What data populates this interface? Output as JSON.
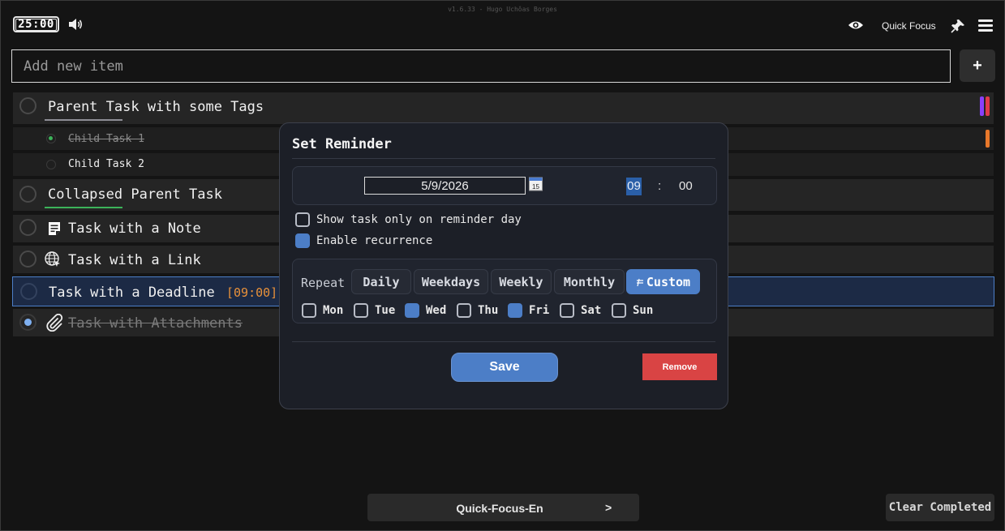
{
  "header": {
    "timer": "25:00",
    "version": "v1.6.33 - Hugo Uchôas Borges",
    "quick_focus_label": "Quick Focus"
  },
  "add_item": {
    "placeholder": "Add new item",
    "add_label": "+"
  },
  "tasks": [
    {
      "label": "Parent Task with some Tags",
      "tags": [
        "#8a3ffc",
        "#e03a4a"
      ]
    },
    {
      "label": "Child Task 1",
      "completed": true,
      "tag": "#e8782a"
    },
    {
      "label": "Child Task 2"
    },
    {
      "label": "Collapsed Parent Task"
    },
    {
      "label": "Task with a Note",
      "icon": "note-icon"
    },
    {
      "label": "Task with a Link",
      "icon": "globe-icon"
    },
    {
      "label": "Task with a Deadline",
      "deadline": "[09:00]"
    },
    {
      "label": "Task with Attachments",
      "icon": "paperclip-icon",
      "completed": true
    }
  ],
  "reminder_dialog": {
    "title": "Set Reminder",
    "date": "5/9/2026",
    "hour": "09",
    "colon": ":",
    "minute": "00",
    "show_only_on_day_label": "Show task only on reminder day",
    "show_only_on_day_checked": false,
    "enable_recurrence_label": "Enable recurrence",
    "enable_recurrence_checked": true,
    "repeat_label": "Repeat",
    "repeat_options": [
      "Daily",
      "Weekdays",
      "Weekly",
      "Monthly",
      "Custom"
    ],
    "repeat_selected": "Custom",
    "days": [
      {
        "label": "Mon",
        "checked": false
      },
      {
        "label": "Tue",
        "checked": false
      },
      {
        "label": "Wed",
        "checked": true
      },
      {
        "label": "Thu",
        "checked": false
      },
      {
        "label": "Fri",
        "checked": true
      },
      {
        "label": "Sat",
        "checked": false
      },
      {
        "label": "Sun",
        "checked": false
      }
    ],
    "save_label": "Save",
    "remove_label": "Remove"
  },
  "footer": {
    "quick_focus_value": "Quick-Focus-En",
    "quick_focus_arrow": ">",
    "clear_completed_label": "Clear Completed"
  },
  "colors": {
    "accent": "#4c7ec7",
    "danger": "#d94444",
    "deadline": "#e8913a",
    "collapsed_underline": "#3cb35a"
  }
}
